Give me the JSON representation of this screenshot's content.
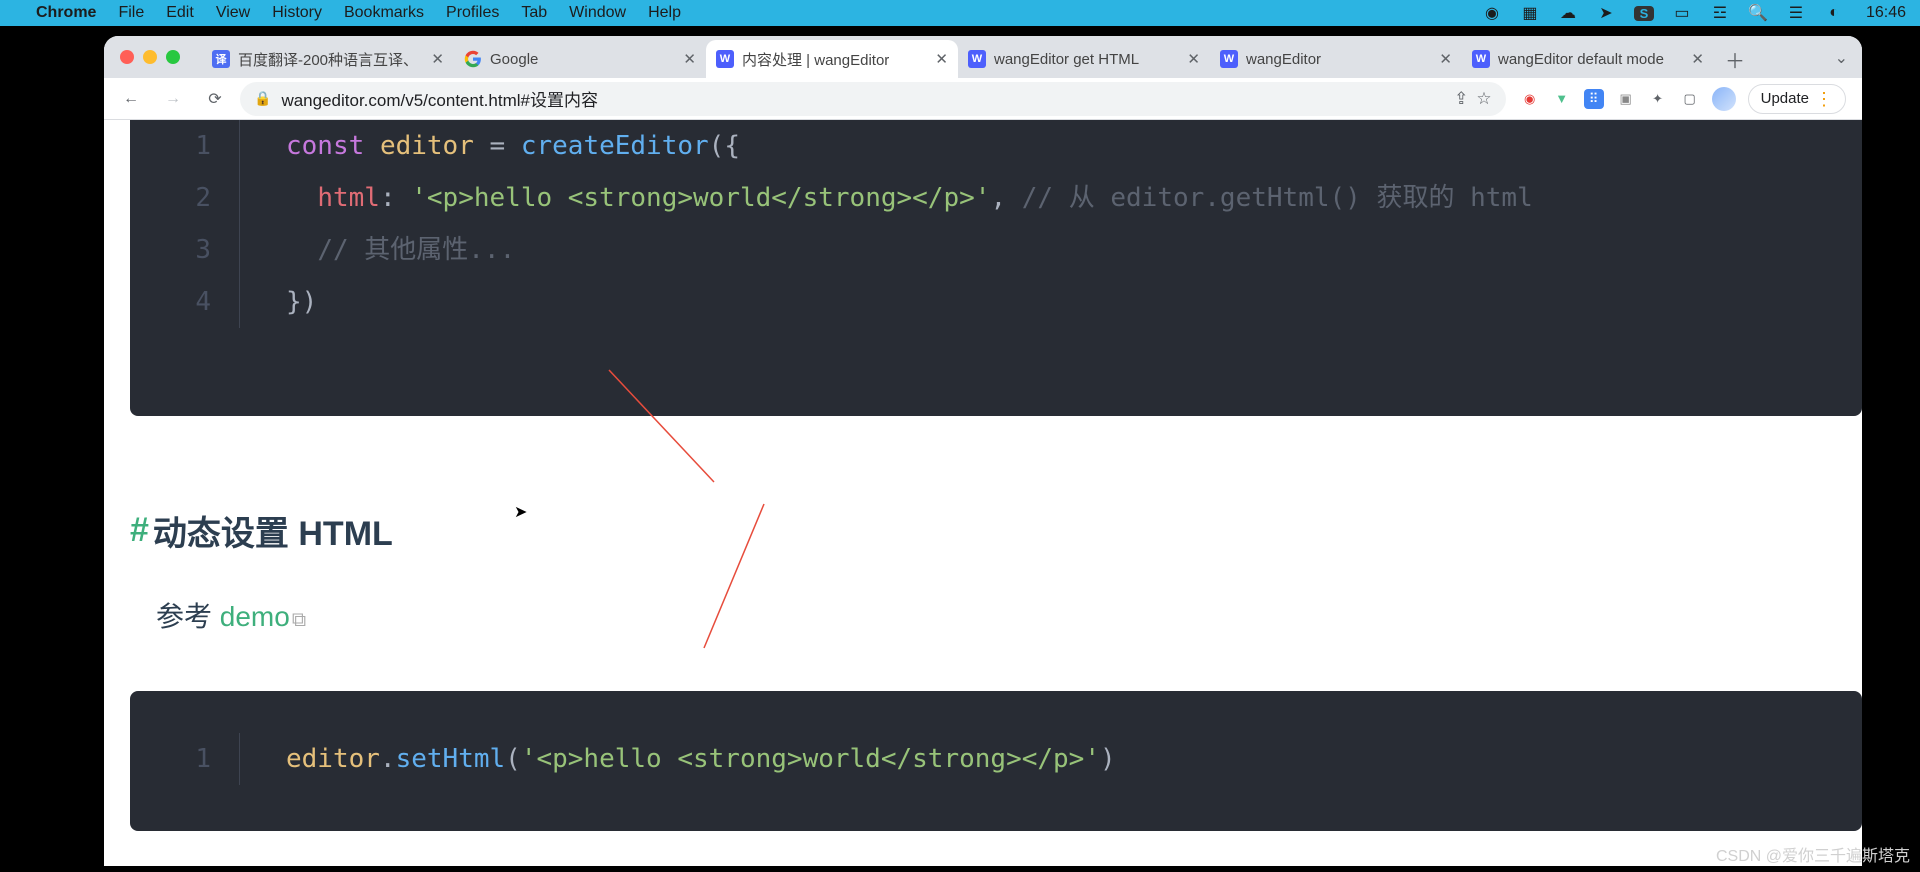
{
  "menubar": {
    "app": "Chrome",
    "items": [
      "File",
      "Edit",
      "View",
      "History",
      "Bookmarks",
      "Profiles",
      "Tab",
      "Window",
      "Help"
    ],
    "clock": "16:46"
  },
  "tabs": [
    {
      "title": "百度翻译-200种语言互译、",
      "fav": "译"
    },
    {
      "title": "Google",
      "fav": "G"
    },
    {
      "title": "内容处理 | wangEditor",
      "fav": "W",
      "active": true
    },
    {
      "title": "wangEditor get HTML",
      "fav": "W"
    },
    {
      "title": "wangEditor",
      "fav": "W"
    },
    {
      "title": "wangEditor default mode",
      "fav": "W"
    }
  ],
  "toolbar": {
    "url": "wangeditor.com/v5/content.html#设置内容",
    "update_label": "Update"
  },
  "page": {
    "code1": {
      "lines": [
        "1",
        "2",
        "3",
        "4"
      ],
      "l1_kw": "const",
      "l1_sp": " ",
      "l1_var": "editor",
      "l1_eq": " = ",
      "l1_fn": "createEditor",
      "l1_rest": "({",
      "l2_attr": "html",
      "l2_colon": ": ",
      "l2_str": "'<p>hello <strong>world</strong></p>'",
      "l2_comma": ", ",
      "l2_cmt": "// 从 editor.getHtml() 获取的 html",
      "l3_cmt": "// 其他属性...",
      "l4": "})"
    },
    "heading_hash": "#",
    "heading_text": " 动态设置 HTML",
    "para_prefix": "参考 ",
    "para_link": "demo",
    "code2": {
      "line": "1",
      "var": "editor",
      "dot": ".",
      "fn": "setHtml",
      "open": "(",
      "str": "'<p>hello <strong>world</strong></p>'",
      "close": ")"
    }
  },
  "watermark": "CSDN @爱你三千遍斯塔克"
}
